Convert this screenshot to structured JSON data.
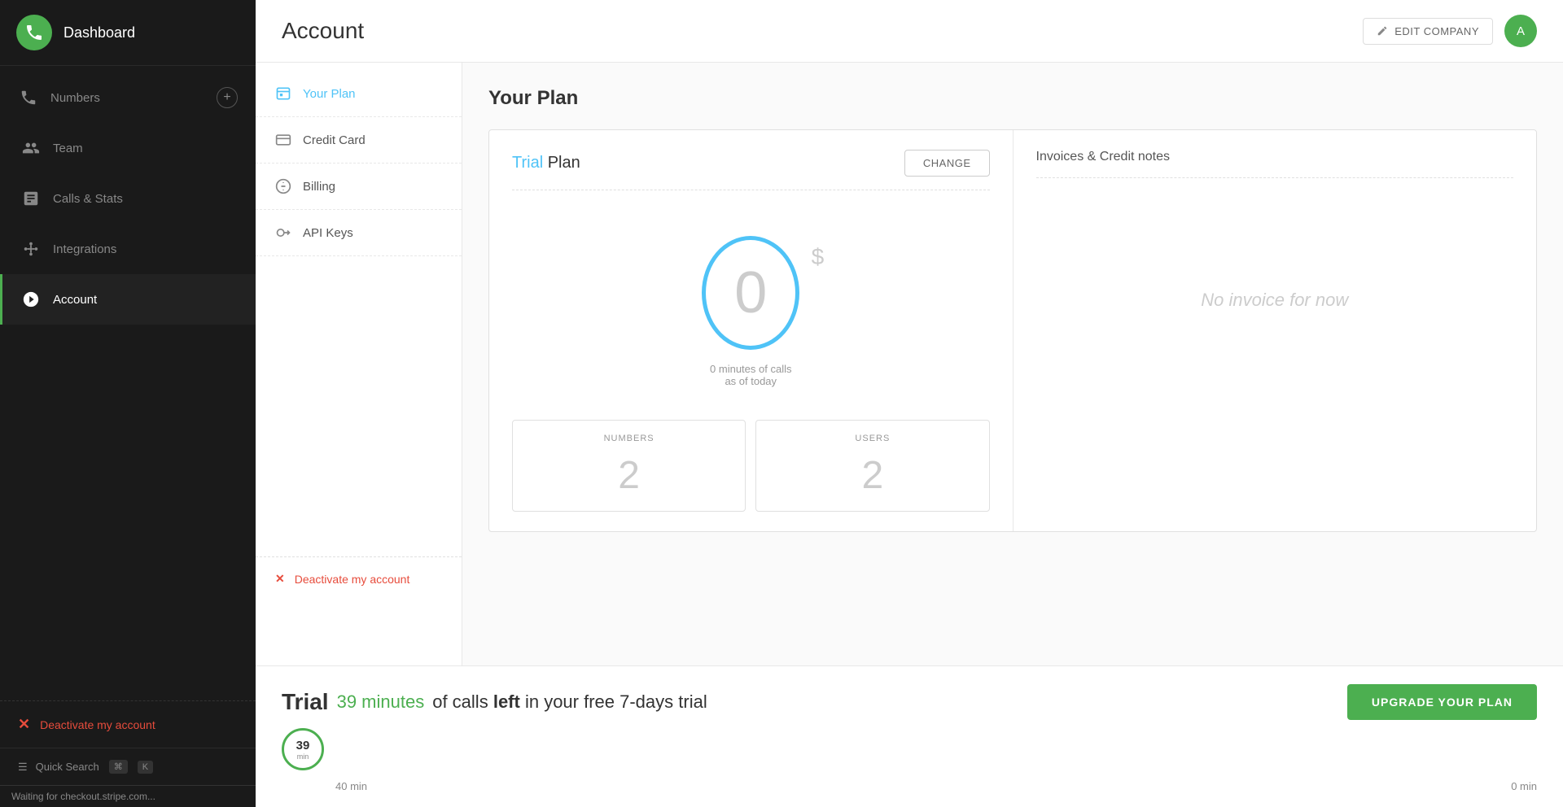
{
  "app": {
    "title": "Dashboard",
    "logo_alt": "phone-logo"
  },
  "sidebar": {
    "items": [
      {
        "id": "numbers",
        "label": "Numbers",
        "icon": "phone-icon",
        "has_add": true
      },
      {
        "id": "team",
        "label": "Team",
        "icon": "team-icon"
      },
      {
        "id": "calls-stats",
        "label": "Calls & Stats",
        "icon": "stats-icon"
      },
      {
        "id": "integrations",
        "label": "Integrations",
        "icon": "integrations-icon"
      },
      {
        "id": "account",
        "label": "Account",
        "icon": "account-icon",
        "active": true
      }
    ],
    "deactivate_label": "Deactivate my account",
    "quick_search_label": "Quick Search",
    "shortcut_1": "⌘",
    "shortcut_2": "K"
  },
  "header": {
    "title": "Account",
    "edit_company_label": "EDIT COMPANY",
    "user_initial": "A"
  },
  "sub_nav": {
    "items": [
      {
        "id": "your-plan",
        "label": "Your Plan",
        "icon": "plan-icon",
        "active": true
      },
      {
        "id": "credit-card",
        "label": "Credit Card",
        "icon": "card-icon"
      },
      {
        "id": "billing",
        "label": "Billing",
        "icon": "billing-icon"
      },
      {
        "id": "api-keys",
        "label": "API Keys",
        "icon": "api-icon"
      }
    ],
    "deactivate_label": "Deactivate my account"
  },
  "page": {
    "section_title_1": "Your",
    "section_title_2": "Plan",
    "plan": {
      "name_prefix": "Trial",
      "name_suffix": "Plan",
      "change_label": "CHANGE",
      "minutes_value": "0",
      "minutes_label": "0 minutes of calls",
      "minutes_sub": "as of today",
      "dollar_sign": "$",
      "numbers_label": "NUMBERS",
      "numbers_value": "2",
      "users_label": "USERS",
      "users_value": "2"
    },
    "invoices": {
      "title": "Invoices & Credit notes",
      "empty_label": "No invoice for now"
    }
  },
  "trial_bar": {
    "title": "Trial",
    "minutes_highlight": "39 minutes",
    "calls_text": "of calls",
    "bold_text": "left",
    "description": "in your free 7-days trial",
    "progress_num": "39",
    "progress_unit": "min",
    "progress_pct": 97.5,
    "label_left": "40 min",
    "label_right": "0 min",
    "upgrade_label": "UPGRADE YOUR PLAN"
  },
  "status_bar": {
    "text": "Waiting for checkout.stripe.com..."
  }
}
